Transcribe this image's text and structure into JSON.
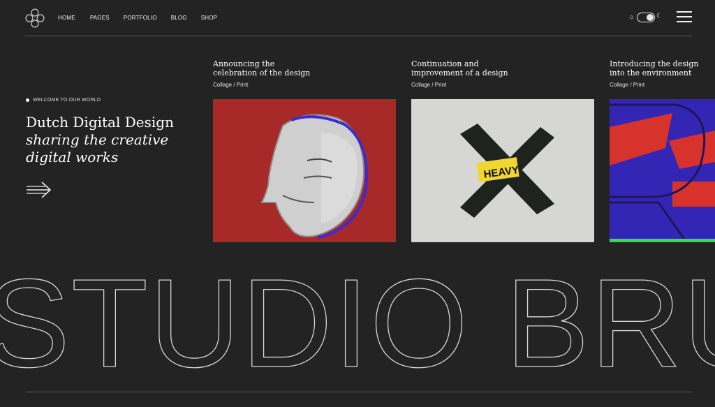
{
  "nav": {
    "items": [
      "HOME",
      "PAGES",
      "PORTFOLIO",
      "BLOG",
      "SHOP"
    ]
  },
  "hero": {
    "welcome": "WELCOME TO OUR WORLD",
    "heading_line1": "Dutch Digital Design",
    "heading_line2": "sharing the creative",
    "heading_line3": "digital works"
  },
  "cards": [
    {
      "title_line1": "Announcing the",
      "title_line2": "celebration of the design",
      "meta": "Collage / Print",
      "image_color": "#a82a28"
    },
    {
      "title_line1": "Continuation and",
      "title_line2": "improvement of a design",
      "meta": "Collage / Print",
      "image_color": "#d6d6d4",
      "sticker_text": "HEAVY"
    },
    {
      "title_line1": "Introducing the design",
      "title_line2": "into the environment",
      "meta": "Collage / Print",
      "image_color": "#3426b4"
    }
  ],
  "marquee": {
    "text": "STUDIO BRUT"
  },
  "colors": {
    "background": "#232323",
    "rule": "#5b5b5b",
    "red": "#a82a28",
    "blue": "#3426b4",
    "green": "#2ee04a"
  },
  "icons": {
    "logo": "four-circles-logo",
    "sun": "sun-icon",
    "moon": "moon-icon",
    "menu": "hamburger-icon",
    "arrow": "arrow-right-icon"
  }
}
